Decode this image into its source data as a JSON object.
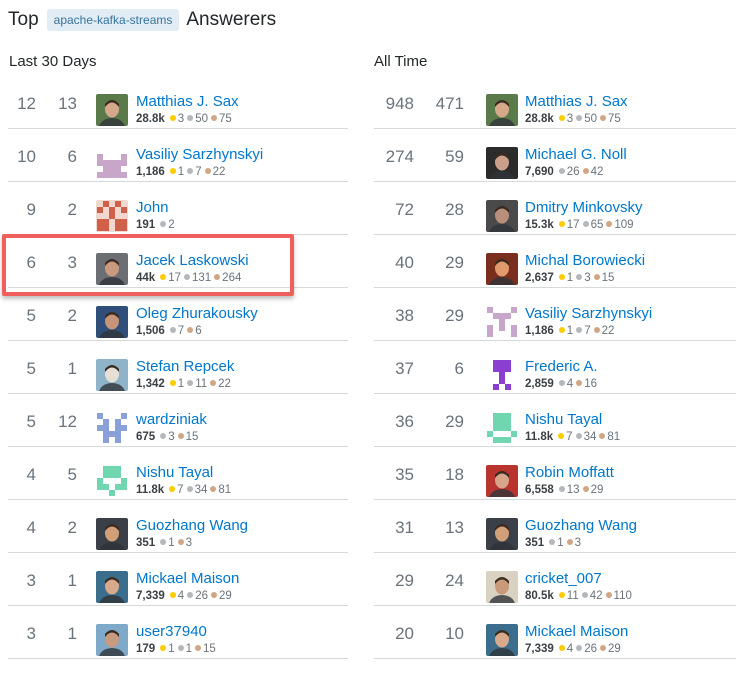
{
  "header": {
    "top": "Top",
    "tag": "apache-kafka-streams",
    "answerers": "Answerers"
  },
  "columns": [
    {
      "title": "Last 30 Days",
      "rows": [
        {
          "n1": "12",
          "n2": "13",
          "name": "Matthias J. Sax",
          "rep": "28.8k",
          "gold": "3",
          "silver": "50",
          "bronze": "75",
          "avatar": "photo",
          "c1": "#5a7a4a",
          "c2": "#d6a88a"
        },
        {
          "n1": "10",
          "n2": "6",
          "name": "Vasiliy Sarzhynskyi",
          "rep": "1,186",
          "gold": "1",
          "silver": "7",
          "bronze": "22",
          "avatar": "identicon",
          "c1": "#c7a6c9",
          "c2": "#ffffff"
        },
        {
          "n1": "9",
          "n2": "2",
          "name": "John",
          "rep": "191",
          "silver": "2",
          "avatar": "identicon",
          "c1": "#d0604a",
          "c2": "#f2d7cf"
        },
        {
          "n1": "6",
          "n2": "3",
          "name": "Jacek Laskowski",
          "rep": "44k",
          "gold": "17",
          "silver": "131",
          "bronze": "264",
          "avatar": "photo",
          "c1": "#6b6f74",
          "c2": "#c99a7f"
        },
        {
          "n1": "5",
          "n2": "2",
          "name": "Oleg Zhurakousky",
          "rep": "1,506",
          "silver": "7",
          "bronze": "6",
          "avatar": "photo",
          "c1": "#2f4f7a",
          "c2": "#c59479"
        },
        {
          "n1": "5",
          "n2": "1",
          "name": "Stefan Repcek",
          "rep": "1,342",
          "gold": "1",
          "silver": "11",
          "bronze": "22",
          "avatar": "photo",
          "c1": "#8fb3c9",
          "c2": "#e6dfd3"
        },
        {
          "n1": "5",
          "n2": "12",
          "name": "wardziniak",
          "rep": "675",
          "silver": "3",
          "bronze": "15",
          "avatar": "identicon",
          "c1": "#8aa0d8",
          "c2": "#ffffff"
        },
        {
          "n1": "4",
          "n2": "5",
          "name": "Nishu Tayal",
          "rep": "11.8k",
          "gold": "7",
          "silver": "34",
          "bronze": "81",
          "avatar": "identicon",
          "c1": "#6fd6b0",
          "c2": "#ffffff"
        },
        {
          "n1": "4",
          "n2": "2",
          "name": "Guozhang Wang",
          "rep": "351",
          "silver": "1",
          "bronze": "3",
          "avatar": "photo",
          "c1": "#3a3f48",
          "c2": "#d1a078"
        },
        {
          "n1": "3",
          "n2": "1",
          "name": "Mickael Maison",
          "rep": "7,339",
          "gold": "4",
          "silver": "26",
          "bronze": "29",
          "avatar": "photo",
          "c1": "#3a6e8c",
          "c2": "#d8a98a"
        },
        {
          "n1": "3",
          "n2": "1",
          "name": "user37940",
          "rep": "179",
          "gold": "1",
          "silver": "1",
          "bronze": "15",
          "avatar": "photo",
          "c1": "#7fa9c9",
          "c2": "#c89a80"
        }
      ]
    },
    {
      "title": "All Time",
      "rows": [
        {
          "n1": "948",
          "n2": "471",
          "name": "Matthias J. Sax",
          "rep": "28.8k",
          "gold": "3",
          "silver": "50",
          "bronze": "75",
          "avatar": "photo",
          "c1": "#5a7a4a",
          "c2": "#d6a88a"
        },
        {
          "n1": "274",
          "n2": "59",
          "name": "Michael G. Noll",
          "rep": "7,690",
          "silver": "26",
          "bronze": "42",
          "avatar": "photo",
          "c1": "#2b2b2b",
          "c2": "#caa08a"
        },
        {
          "n1": "72",
          "n2": "28",
          "name": "Dmitry Minkovsky",
          "rep": "15.3k",
          "gold": "17",
          "silver": "65",
          "bronze": "109",
          "avatar": "photo",
          "c1": "#4a4a4a",
          "c2": "#b88f7b"
        },
        {
          "n1": "40",
          "n2": "29",
          "name": "Michal Borowiecki",
          "rep": "2,637",
          "gold": "1",
          "silver": "3",
          "bronze": "15",
          "avatar": "photo",
          "c1": "#7a2f1e",
          "c2": "#e09a6b"
        },
        {
          "n1": "38",
          "n2": "29",
          "name": "Vasiliy Sarzhynskyi",
          "rep": "1,186",
          "gold": "1",
          "silver": "7",
          "bronze": "22",
          "avatar": "identicon",
          "c1": "#c7a6c9",
          "c2": "#ffffff"
        },
        {
          "n1": "37",
          "n2": "6",
          "name": "Frederic A.",
          "rep": "2,859",
          "silver": "4",
          "bronze": "16",
          "avatar": "identicon",
          "c1": "#8a3fd0",
          "c2": "#ffffff"
        },
        {
          "n1": "36",
          "n2": "29",
          "name": "Nishu Tayal",
          "rep": "11.8k",
          "gold": "7",
          "silver": "34",
          "bronze": "81",
          "avatar": "identicon",
          "c1": "#6fd6b0",
          "c2": "#ffffff"
        },
        {
          "n1": "35",
          "n2": "18",
          "name": "Robin Moffatt",
          "rep": "6,558",
          "silver": "13",
          "bronze": "29",
          "avatar": "photo",
          "c1": "#b8352e",
          "c2": "#d9a58a"
        },
        {
          "n1": "31",
          "n2": "13",
          "name": "Guozhang Wang",
          "rep": "351",
          "silver": "1",
          "bronze": "3",
          "avatar": "photo",
          "c1": "#3a3f48",
          "c2": "#d1a078"
        },
        {
          "n1": "29",
          "n2": "24",
          "name": "cricket_007",
          "rep": "80.5k",
          "gold": "11",
          "silver": "42",
          "bronze": "110",
          "avatar": "photo",
          "c1": "#d9d2c3",
          "c2": "#c99a7a"
        },
        {
          "n1": "20",
          "n2": "10",
          "name": "Mickael Maison",
          "rep": "7,339",
          "gold": "4",
          "silver": "26",
          "bronze": "29",
          "avatar": "photo",
          "c1": "#3a6e8c",
          "c2": "#d8a98a"
        }
      ]
    }
  ]
}
